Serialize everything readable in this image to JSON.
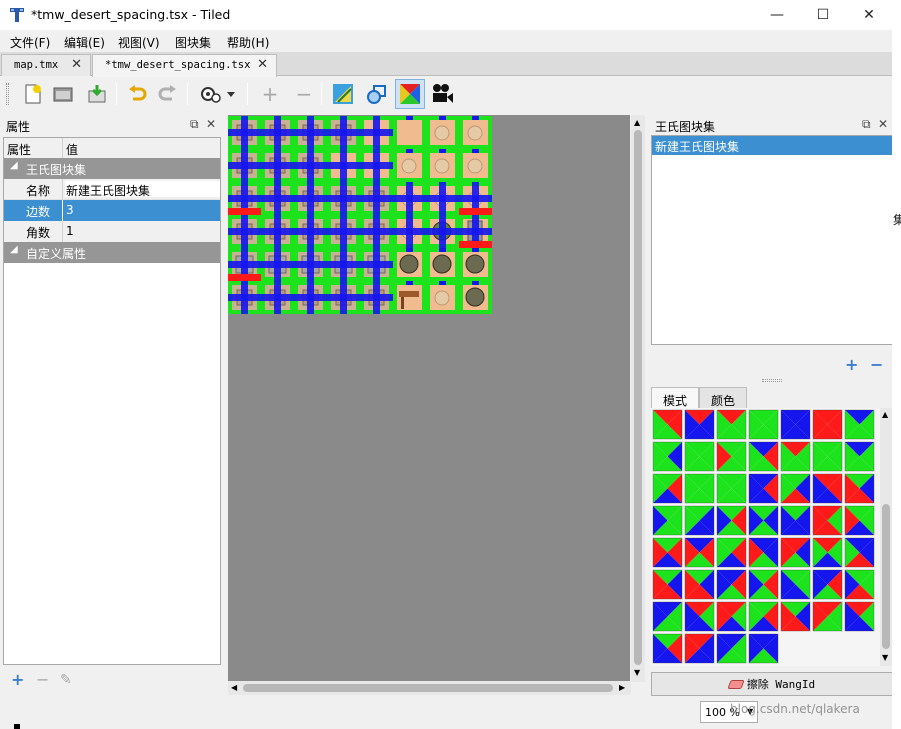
{
  "window": {
    "title": "*tmw_desert_spacing.tsx - Tiled",
    "minimize": "—",
    "maximize": "☐",
    "close": "✕"
  },
  "menu": [
    "文件(F)",
    "编辑(E)",
    "视图(V)",
    "图块集",
    "帮助(H)"
  ],
  "doc_tabs": [
    {
      "label": "map.tmx",
      "active": false
    },
    {
      "label": "*tmw_desert_spacing.tsx",
      "active": true
    }
  ],
  "toolbar": {
    "icons": [
      "new-file-icon",
      "open-folder-icon",
      "save-icon",
      "undo-icon",
      "redo-icon",
      "settings-icon",
      "add-tile-icon",
      "remove-tile-icon",
      "terrain-icon",
      "collision-icon",
      "wang-icon",
      "animation-icon"
    ]
  },
  "properties": {
    "title": "属性",
    "col_name": "属性",
    "col_value": "值",
    "group1": "王氏图块集",
    "rows": [
      {
        "name": "名称",
        "value": "新建王氏图块集",
        "selected": false
      },
      {
        "name": "边数",
        "value": "3",
        "selected": true
      },
      {
        "name": "角数",
        "value": "1",
        "selected": false
      }
    ],
    "group2": "自定义属性"
  },
  "wang_sets": {
    "title": "王氏图块集",
    "items": [
      "新建王氏图块集"
    ],
    "add": "+",
    "remove": "−"
  },
  "wang_tabs": [
    {
      "label": "模式",
      "active": true
    },
    {
      "label": "颜色",
      "active": false
    }
  ],
  "erase_button": "擦除 WangId",
  "zoom": "100 %",
  "watermark": "blog.csdn.net/qlakera",
  "colors": {
    "accent": "#3c8fd0",
    "wang_red": "#ff1a1a",
    "wang_green": "#1de31d",
    "wang_blue": "#1515ee",
    "dark_green": "#1e7e1e",
    "dark_blue": "#0a0a8a",
    "dark_red": "#8a1a1a"
  },
  "wang_patterns": [
    [
      "R",
      "R",
      "G",
      "G",
      "R",
      "B",
      "B",
      "B",
      "R",
      "G",
      "G",
      "G",
      "G",
      "G",
      "G",
      "G",
      "B",
      "B",
      "B",
      "B",
      "R",
      "R",
      "R",
      "R",
      "B",
      "G",
      "G",
      "G"
    ],
    [
      "G",
      "B",
      "G",
      "G",
      "G",
      "G",
      "G",
      "G",
      "G",
      "G",
      "G",
      "R",
      "B",
      "R",
      "G",
      "G",
      "R",
      "G",
      "G",
      "G",
      "G",
      "G",
      "G",
      "G",
      "B",
      "G",
      "G",
      "G"
    ],
    [
      "G",
      "R",
      "B",
      "G",
      "G",
      "G",
      "G",
      "G",
      "G",
      "G",
      "G",
      "G",
      "B",
      "R",
      "B",
      "B",
      "G",
      "B",
      "R",
      "G",
      "R",
      "R",
      "B",
      "B",
      "G",
      "B",
      "R",
      "R"
    ],
    [
      "G",
      "G",
      "G",
      "B",
      "G",
      "B",
      "B",
      "G",
      "G",
      "R",
      "G",
      "B",
      "G",
      "B",
      "G",
      "B",
      "G",
      "B",
      "B",
      "B",
      "R",
      "G",
      "R",
      "R",
      "G",
      "G",
      "B",
      "R"
    ],
    [
      "G",
      "R",
      "B",
      "R",
      "B",
      "R",
      "G",
      "R",
      "G",
      "R",
      "B",
      "G",
      "B",
      "B",
      "G",
      "R",
      "R",
      "B",
      "G",
      "R",
      "R",
      "G",
      "B",
      "G",
      "B",
      "B",
      "R",
      "G"
    ],
    [
      "G",
      "B",
      "R",
      "R",
      "G",
      "B",
      "R",
      "R",
      "B",
      "R",
      "G",
      "B",
      "G",
      "R",
      "G",
      "B",
      "G",
      "G",
      "B",
      "B",
      "B",
      "R",
      "G",
      "B",
      "G",
      "G",
      "R",
      "B"
    ],
    [
      "B",
      "G",
      "G",
      "B",
      "R",
      "G",
      "B",
      "B",
      "R",
      "G",
      "B",
      "R",
      "G",
      "R",
      "B",
      "G",
      "G",
      "B",
      "R",
      "R",
      "R",
      "G",
      "G",
      "R",
      "R",
      "G",
      "B",
      "B"
    ],
    [
      "G",
      "R",
      "B",
      "B",
      "R",
      "B",
      "B",
      "R",
      "B",
      "G",
      "G",
      "B",
      "B",
      "B",
      "G",
      "B"
    ]
  ]
}
